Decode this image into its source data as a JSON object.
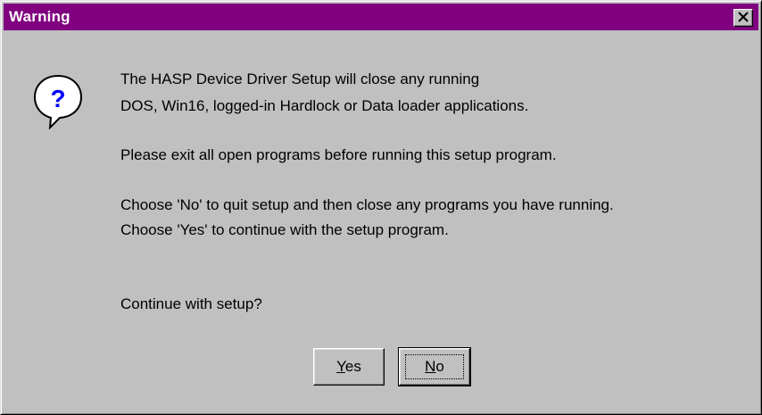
{
  "window": {
    "title": "Warning",
    "titlebar_color": "#800080",
    "close_icon": "close-icon"
  },
  "dialog": {
    "icon": "question-icon",
    "icon_glyph": "?",
    "message_lines": [
      "The HASP Device Driver Setup will close any running",
      "DOS, Win16, logged-in Hardlock or Data loader applications.",
      "Please exit all open programs before running this setup program.",
      "Choose 'No' to quit setup and then close any programs you have running.",
      "Choose 'Yes' to continue with the setup program.",
      "Continue with setup?"
    ]
  },
  "buttons": {
    "yes": {
      "mnemonic": "Y",
      "rest": "es"
    },
    "no": {
      "mnemonic": "N",
      "rest": "o"
    }
  }
}
